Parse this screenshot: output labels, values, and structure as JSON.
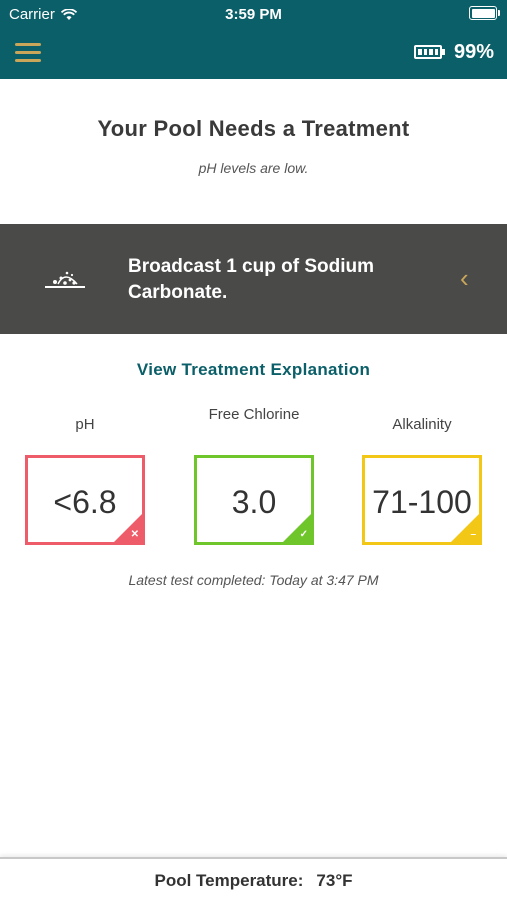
{
  "status_bar": {
    "carrier": "Carrier",
    "time": "3:59 PM"
  },
  "header": {
    "battery_percent": "99%"
  },
  "title": "Your Pool Needs a Treatment",
  "subtitle": "pH levels are low.",
  "treatment": {
    "instruction": "Broadcast 1 cup of Sodium Carbonate.",
    "icon": "chemical-pour-icon"
  },
  "explain_link": "View Treatment Explanation",
  "metrics": [
    {
      "label": "pH",
      "value": "<6.8",
      "status": "low",
      "color": "#ee5c6a",
      "icon": "close-icon"
    },
    {
      "label": "Free Chlorine",
      "value": "3.0",
      "status": "ok",
      "color": "#6fc62a",
      "icon": "check-icon"
    },
    {
      "label": "Alkalinity",
      "value": "71-100",
      "status": "fair",
      "color": "#f2c715",
      "icon": "minus-icon"
    }
  ],
  "latest_test": "Latest test completed: Today at 3:47 PM",
  "footer": {
    "label": "Pool Temperature:",
    "value": "73°F"
  },
  "colors": {
    "header_bg": "#0b5f68",
    "accent": "#c9a659",
    "banner_bg": "#4a4a48"
  }
}
